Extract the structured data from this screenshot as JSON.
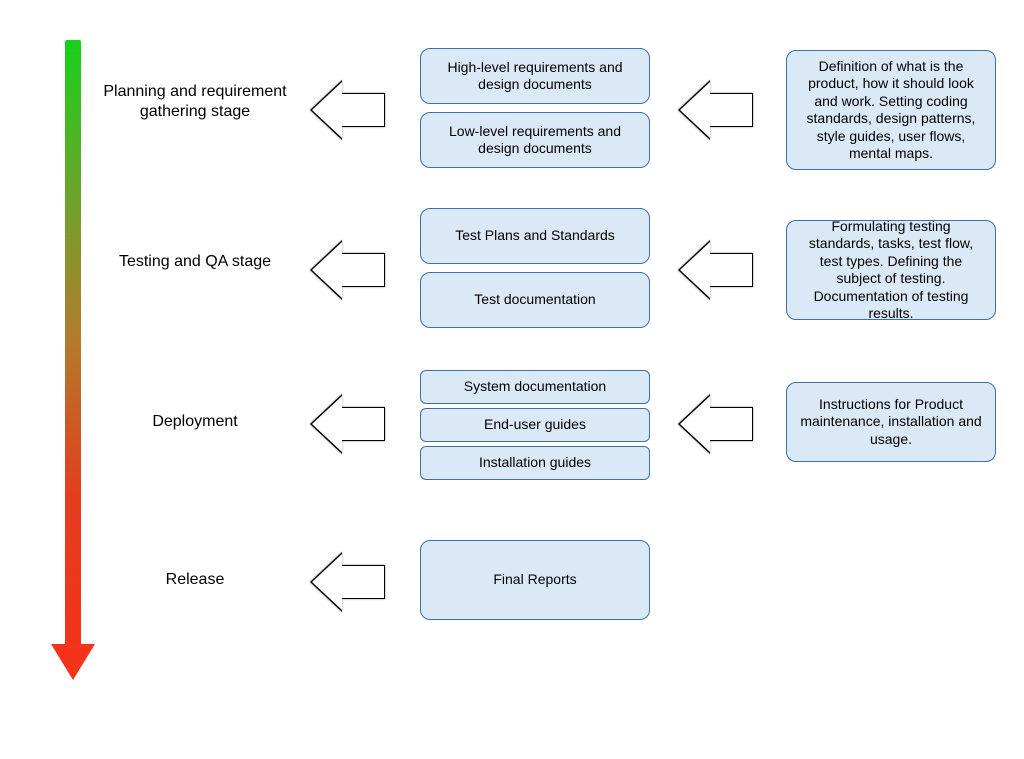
{
  "stages": {
    "planning": {
      "label": "Planning and requirement gathering stage"
    },
    "testing": {
      "label": "Testing and QA stage"
    },
    "deployment": {
      "label": "Deployment"
    },
    "release": {
      "label": "Release"
    }
  },
  "boxes": {
    "highReq": "High-level requirements and design documents",
    "lowReq": "Low-level requirements and design documents",
    "testPlans": "Test Plans and Standards",
    "testDocs": "Test documentation",
    "sysDocs": "System documentation",
    "userGuides": "End-user guides",
    "installGuides": "Installation guides",
    "finalReports": "Final Reports"
  },
  "descriptions": {
    "planning": "Definition of what is the product, how it should look and work. Setting coding standards, design patterns, style guides, user flows, mental maps.",
    "testing": "Formulating testing standards, tasks, test flow, test types. Defining the subject of testing. Documentation of testing results.",
    "deployment": "Instructions for Product maintenance, installation and usage."
  }
}
